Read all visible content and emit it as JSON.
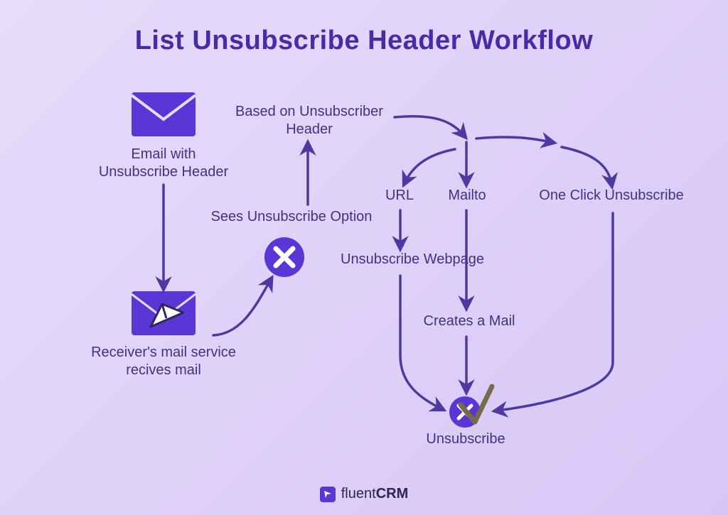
{
  "title": "List Unsubscribe Header Workflow",
  "nodes": {
    "email_with_header": "Email with Unsubscribe Header",
    "receiver_mail": "Receiver's mail service recives mail",
    "sees_option": "Sees Unsubscribe Option",
    "based_on_header": "Based on Unsubscriber Header",
    "url": "URL",
    "mailto": "Mailto",
    "one_click": "One Click Unsubscribe",
    "unsub_webpage": "Unsubscribe Webpage",
    "creates_mail": "Creates a Mail",
    "unsubscribe": "Unsubscribe"
  },
  "brand": {
    "name_light": "fluent",
    "name_bold": "CRM"
  },
  "colors": {
    "title": "#4b2aa8",
    "stroke": "#4d3aa0",
    "icon_fill": "#5a36d6",
    "text": "#3f347d"
  }
}
